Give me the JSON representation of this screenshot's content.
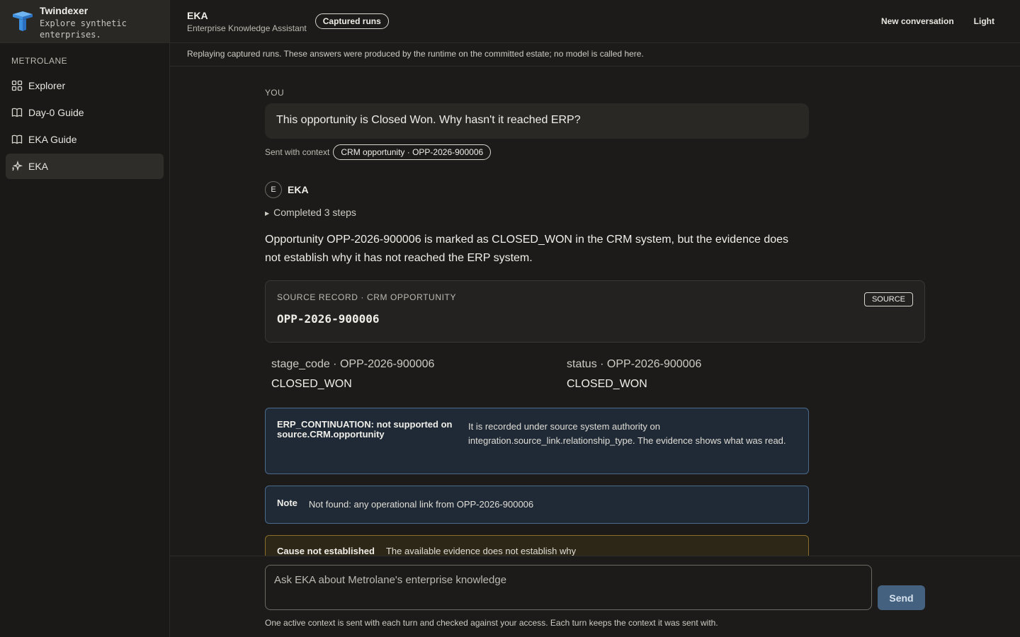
{
  "brand": {
    "name": "Twindexer",
    "tagline": "Explore synthetic enterprises."
  },
  "sidebar": {
    "org_label": "METROLANE",
    "items": [
      {
        "label": "Explorer",
        "icon": "grid-icon"
      },
      {
        "label": "Day-0 Guide",
        "icon": "book-icon"
      },
      {
        "label": "EKA Guide",
        "icon": "book-icon"
      },
      {
        "label": "EKA",
        "icon": "sparkle-icon",
        "active": true
      }
    ]
  },
  "header": {
    "title": "EKA",
    "subtitle": "Enterprise Knowledge Assistant",
    "badge": "Captured runs",
    "new_conversation": "New conversation",
    "theme_toggle": "Light"
  },
  "banner": "Replaying captured runs. These answers were produced by the runtime on the committed estate; no model is called here.",
  "conversation": {
    "you_label": "YOU",
    "user_message": "This opportunity is Closed Won. Why hasn't it reached ERP?",
    "context_prefix": "Sent with context",
    "context_chip": "CRM opportunity · OPP-2026-900006",
    "assistant_avatar": "E",
    "assistant_name": "EKA",
    "steps": "Completed 3 steps",
    "answer": "Opportunity OPP-2026-900006 is marked as CLOSED_WON in the CRM system, but the evidence does not establish why it has not reached the ERP system.",
    "source_card": {
      "label": "SOURCE RECORD · CRM OPPORTUNITY",
      "record_id": "OPP-2026-900006",
      "button": "SOURCE"
    },
    "fields": [
      {
        "key": "stage_code · OPP-2026-900006",
        "value": "CLOSED_WON"
      },
      {
        "key": "status · OPP-2026-900006",
        "value": "CLOSED_WON"
      }
    ],
    "info": {
      "title": "ERP_CONTINUATION: not supported on source.CRM.opportunity",
      "text": "It is recorded under source system authority on integration.source_link.relationship_type. The evidence shows what was read."
    },
    "note": {
      "title": "Note",
      "text": "Not found: any operational link from OPP-2026-900006"
    },
    "warning": {
      "title": "Cause not established",
      "text": "The available evidence does not establish why"
    }
  },
  "composer": {
    "placeholder": "Ask EKA about Metrolane's enterprise knowledge",
    "send": "Send",
    "note": "One active context is sent with each turn and checked against your access. Each turn keeps the context it was sent with."
  },
  "colors": {
    "background": "#1c1b19",
    "info_border": "#4a6a8c",
    "warning_border": "#8a6f2a",
    "send_button": "#44627f",
    "logo_blue": "#3d8fe0"
  }
}
